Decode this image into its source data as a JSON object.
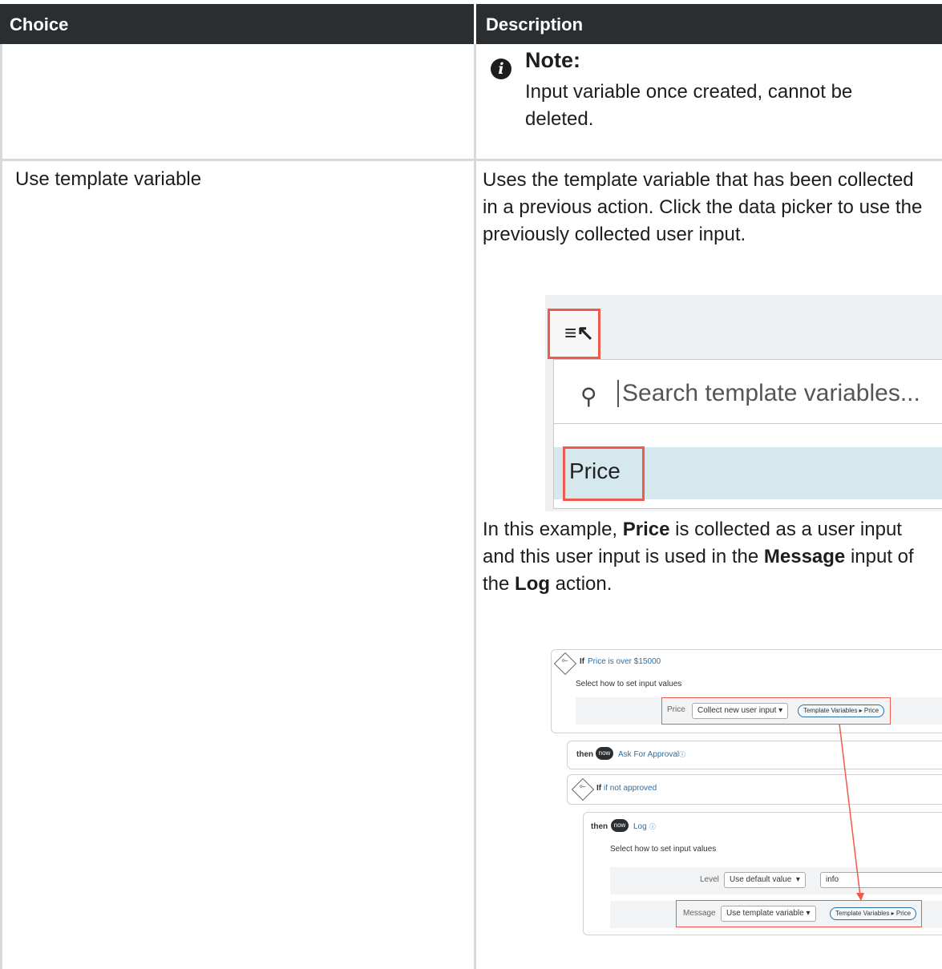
{
  "table": {
    "headers": [
      "Choice",
      "Description"
    ]
  },
  "note": {
    "title": "Note:",
    "text": "Input variable once created, cannot be deleted."
  },
  "row": {
    "choice": "Use template variable",
    "description": "Uses the template variable that has been collected in a previous action. Click the data picker to use the previously collected user input.",
    "example": {
      "p1": "In this example, ",
      "b1": "Price",
      "p2": " is collected as a user input and this user input is used in the ",
      "b2": "Message",
      "p3": " input of the ",
      "b3": "Log",
      "p4": " action."
    }
  },
  "picker": {
    "search_placeholder": "Search template variables...",
    "item": "Price"
  },
  "flow": {
    "if1_label": "If",
    "if1_condition": "Price is over $15000",
    "select_how": "Select how to set input values",
    "price_label": "Price",
    "collect_option": "Collect new user input",
    "pill": "Template Variables ▸ Price",
    "then": "then",
    "now": "now",
    "ask_approval": "Ask For Approval",
    "if2_label": "If",
    "if2_condition": "if not approved",
    "log": "Log",
    "level_label": "Level",
    "level_option": "Use default value",
    "level_value": "info",
    "message_label": "Message",
    "message_option": "Use template variable",
    "accent_red": "#ee5a4c",
    "header_bg": "#2a2e31"
  }
}
